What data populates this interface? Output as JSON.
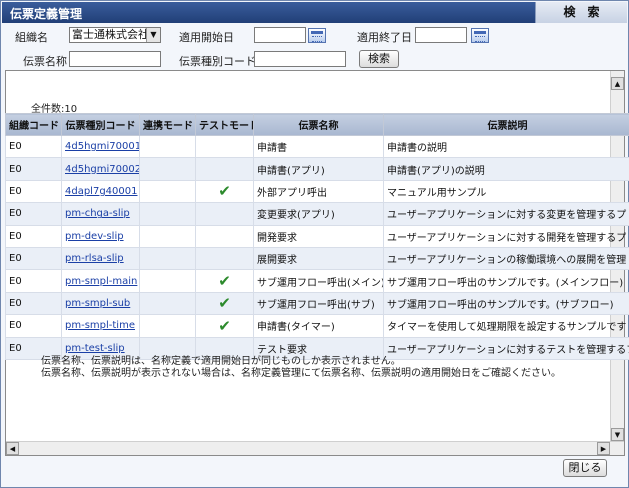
{
  "window": {
    "title": "伝票定義管理",
    "search_tab": "検　索"
  },
  "form": {
    "org_label": "組織名",
    "org_value": "富士通株式会社",
    "start_label": "適用開始日",
    "start_value": "",
    "end_label": "適用終了日",
    "end_value": "",
    "name_label": "伝票名称",
    "name_value": "",
    "type_label": "伝票種別コード",
    "type_value": "",
    "search_button": "検索"
  },
  "result": {
    "count_text": "全件数:10"
  },
  "table": {
    "headers": [
      "組織コード",
      "伝票種別コード",
      "連携モード",
      "テストモード",
      "伝票名称",
      "伝票説明"
    ],
    "rows": [
      {
        "org": "E0",
        "code": "4d5hgmi70001",
        "link_mode": "",
        "test_mode": false,
        "name": "申請書",
        "desc": "申請書の説明"
      },
      {
        "org": "E0",
        "code": "4d5hgmi70002",
        "link_mode": "",
        "test_mode": false,
        "name": "申請書(アプリ)",
        "desc": "申請書(アプリ)の説明"
      },
      {
        "org": "E0",
        "code": "4dapl7g40001",
        "link_mode": "",
        "test_mode": true,
        "name": "外部アプリ呼出",
        "desc": "マニュアル用サンプル"
      },
      {
        "org": "E0",
        "code": "pm-chga-slip",
        "link_mode": "",
        "test_mode": false,
        "name": "変更要求(アプリ)",
        "desc": "ユーザーアプリケーションに対する変更を管理するプ"
      },
      {
        "org": "E0",
        "code": "pm-dev-slip",
        "link_mode": "",
        "test_mode": false,
        "name": "開発要求",
        "desc": "ユーザーアプリケーションに対する開発を管理するプ"
      },
      {
        "org": "E0",
        "code": "pm-rlsa-slip",
        "link_mode": "",
        "test_mode": false,
        "name": "展開要求",
        "desc": "ユーザーアプリケーションの稼働環境への展開を管理"
      },
      {
        "org": "E0",
        "code": "pm-smpl-main",
        "link_mode": "",
        "test_mode": true,
        "name": "サブ運用フロー呼出(メイン)",
        "desc": "サブ運用フロー呼出のサンプルです。(メインフロー)"
      },
      {
        "org": "E0",
        "code": "pm-smpl-sub",
        "link_mode": "",
        "test_mode": true,
        "name": "サブ運用フロー呼出(サブ)",
        "desc": "サブ運用フロー呼出のサンプルです。(サブフロー)"
      },
      {
        "org": "E0",
        "code": "pm-smpl-time",
        "link_mode": "",
        "test_mode": true,
        "name": "申請書(タイマー)",
        "desc": "タイマーを使用して処理期限を設定するサンプルです"
      },
      {
        "org": "E0",
        "code": "pm-test-slip",
        "link_mode": "",
        "test_mode": false,
        "name": "テスト要求",
        "desc": "ユーザーアプリケーションに対するテストを管理するプ"
      }
    ]
  },
  "notes": [
    "伝票名称、伝票説明は、名称定義で適用開始日が同じものしか表示されません。",
    "伝票名称、伝票説明が表示されない場合は、名称定義管理にて伝票名称、伝票説明の適用開始日をご確認ください。"
  ],
  "footer": {
    "close_button": "閉じる"
  },
  "icons": {
    "calendar": "calendar-icon",
    "check": "checkmark-icon",
    "dropdown": "chevron-down-icon"
  },
  "colors": {
    "title_bar": "#2b4b86",
    "header_row": "#b3c1d8",
    "alt_row": "#eaeff7",
    "check": "#2c8a2c",
    "link": "#1a3fa6"
  }
}
